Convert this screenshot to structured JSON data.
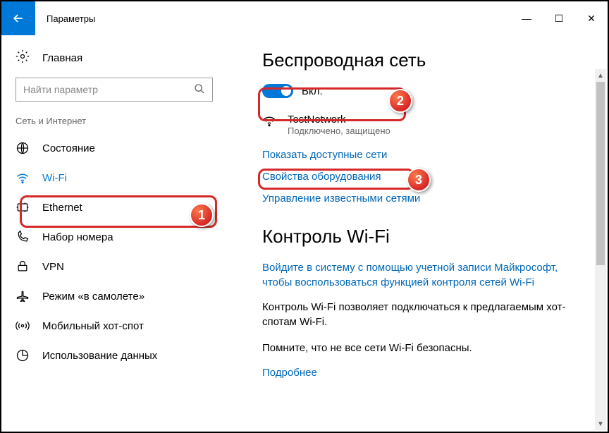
{
  "titlebar": {
    "title": "Параметры"
  },
  "sidebar": {
    "home": "Главная",
    "search_placeholder": "Найти параметр",
    "section": "Сеть и Интернет",
    "items": [
      {
        "label": "Состояние"
      },
      {
        "label": "Wi-Fi"
      },
      {
        "label": "Ethernet"
      },
      {
        "label": "Набор номера"
      },
      {
        "label": "VPN"
      },
      {
        "label": "Режим «в самолете»"
      },
      {
        "label": "Мобильный хот-спот"
      },
      {
        "label": "Использование данных"
      }
    ]
  },
  "main": {
    "heading1": "Беспроводная сеть",
    "toggle_label": "Вкл.",
    "network": {
      "name": "TestNetwork",
      "status": "Подключено, защищено"
    },
    "link_available": "Показать доступные сети",
    "link_hardware": "Свойства оборудования",
    "link_known": "Управление известными сетями",
    "heading2": "Контроль Wi-Fi",
    "link_signin": "Войдите в систему с помощью учетной записи Майкрософт, чтобы воспользоваться функцией контроля сетей Wi-Fi",
    "para1": "Контроль Wi-Fi позволяет подключаться к предлагаемым хот-спотам Wi-Fi.",
    "para2": "Помните, что не все сети Wi-Fi безопасны.",
    "link_more": "Подробнее"
  },
  "badges": {
    "b1": "1",
    "b2": "2",
    "b3": "3"
  }
}
